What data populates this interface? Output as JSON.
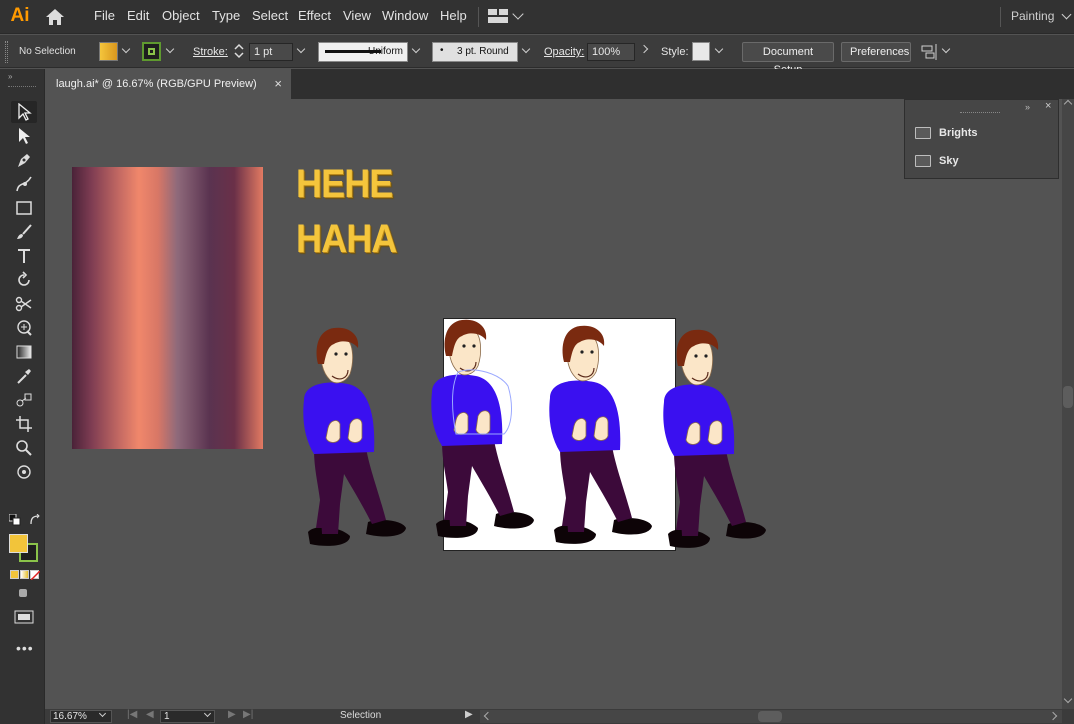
{
  "app": {
    "logo": "Ai",
    "workspace": "Painting"
  },
  "menu": [
    "File",
    "Edit",
    "Object",
    "Type",
    "Select",
    "Effect",
    "View",
    "Window",
    "Help"
  ],
  "options": {
    "selection": "No Selection",
    "stroke_label": "Stroke:",
    "stroke_weight": "1 pt",
    "profile": "Uniform",
    "brush": "3 pt. Round",
    "opacity_label": "Opacity:",
    "opacity_value": "100%",
    "style_label": "Style:",
    "document_setup": "Document Setup",
    "preferences": "Preferences"
  },
  "tab": {
    "title": "laugh.ai* @ 16.67% (RGB/GPU Preview)",
    "close": "×"
  },
  "panel": {
    "items": [
      "Brights",
      "Sky"
    ]
  },
  "canvas": {
    "text_line1": "HEHE",
    "text_line2": "HAHA"
  },
  "status": {
    "zoom": "16.67%",
    "artboard": "1",
    "mode": "Selection"
  },
  "colors": {
    "fill": "#f4c53c",
    "shirt": "#3a10f0",
    "pants": "#3c0a3a",
    "hair": "#7a2a10",
    "skin": "#fbe6c8"
  }
}
